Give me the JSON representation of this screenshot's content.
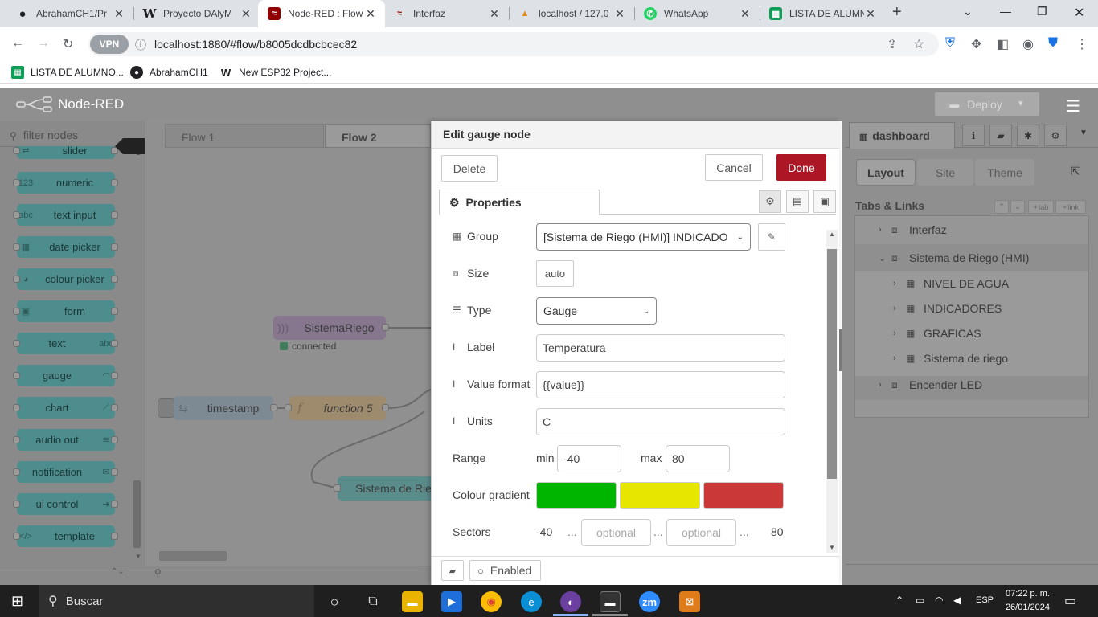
{
  "browser": {
    "tabs": [
      {
        "title": "AbrahamCH1/Pr",
        "favicon": "github-icon",
        "active": false
      },
      {
        "title": "Proyecto DAlyM",
        "favicon": "wordpress-icon",
        "active": false
      },
      {
        "title": "Node-RED : Flow",
        "favicon": "nodered-icon",
        "active": true
      },
      {
        "title": "Interfaz",
        "favicon": "nodered-icon",
        "active": false
      },
      {
        "title": "localhost / 127.0",
        "favicon": "phpmyadmin-icon",
        "active": false
      },
      {
        "title": "WhatsApp",
        "favicon": "whatsapp-icon",
        "active": false
      },
      {
        "title": "LISTA DE ALUMN",
        "favicon": "sheets-icon",
        "active": false
      }
    ],
    "url": "localhost:1880/#flow/b8005dcdbcbcec82",
    "vpn_label": "VPN",
    "bookmarks": [
      {
        "label": "LISTA DE ALUMNO...",
        "icon": "sheets-icon"
      },
      {
        "label": "AbrahamCH1",
        "icon": "github-icon"
      },
      {
        "label": "New ESP32 Project...",
        "icon": "wokwi-icon"
      }
    ]
  },
  "nodered": {
    "app_title": "Node-RED",
    "deploy_label": "Deploy",
    "palette": {
      "filter_placeholder": "filter nodes",
      "nodes": [
        {
          "label": "slider",
          "icon": "slider-icon"
        },
        {
          "label": "numeric",
          "icon": "numeric-icon"
        },
        {
          "label": "text input",
          "icon": "text-input-icon"
        },
        {
          "label": "date picker",
          "icon": "calendar-icon"
        },
        {
          "label": "colour picker",
          "icon": "palette-icon"
        },
        {
          "label": "form",
          "icon": "form-icon"
        },
        {
          "label": "text",
          "icon": "text-icon"
        },
        {
          "label": "gauge",
          "icon": "gauge-icon"
        },
        {
          "label": "chart",
          "icon": "chart-icon"
        },
        {
          "label": "audio out",
          "icon": "audio-icon"
        },
        {
          "label": "notification",
          "icon": "envelope-icon"
        },
        {
          "label": "ui control",
          "icon": "arrow-icon"
        },
        {
          "label": "template",
          "icon": "code-icon"
        }
      ]
    },
    "workspace": {
      "tabs": [
        "Flow 1",
        "Flow 2"
      ],
      "flow_nodes": {
        "sistema_riego": "SistemaRiego",
        "status_connected": "connected",
        "timestamp": "timestamp",
        "function5": "function 5",
        "sistema_de_rie": "Sistema de Rie"
      }
    },
    "tray": {
      "title": "Edit gauge node",
      "delete_label": "Delete",
      "cancel_label": "Cancel",
      "done_label": "Done",
      "properties_tab": "Properties",
      "fields": {
        "group_label": "Group",
        "group_value": "[Sistema de Riego (HMI)] INDICADORES",
        "size_label": "Size",
        "size_value": "auto",
        "type_label": "Type",
        "type_value": "Gauge",
        "label_label": "Label",
        "label_value": "Temperatura",
        "value_format_label": "Value format",
        "value_format_value": "{{value}}",
        "units_label": "Units",
        "units_value": "C",
        "range_label": "Range",
        "min_label": "min",
        "min_value": "-40",
        "max_label": "max",
        "max_value": "80",
        "colour_gradient_label": "Colour gradient",
        "colours": [
          "#00b500",
          "#e6e600",
          "#ca3838"
        ],
        "sectors_label": "Sectors",
        "sector_start": "-40",
        "sector_sep": "...",
        "sector_placeholder_1": "optional",
        "sector_placeholder_2": "optional",
        "sector_end": "80"
      },
      "enabled_label": "Enabled"
    },
    "sidebar": {
      "tab_label": "dashboard",
      "pills": [
        "Layout",
        "Site",
        "Theme"
      ],
      "section_title": "Tabs & Links",
      "small_buttons": [
        "tab",
        "link"
      ],
      "tree": [
        {
          "label": "Interfaz",
          "level": 0,
          "expanded": false
        },
        {
          "label": "Sistema de Riego (HMI)",
          "level": 0,
          "expanded": true
        },
        {
          "label": "NIVEL DE AGUA",
          "level": 1,
          "expanded": false
        },
        {
          "label": "INDICADORES",
          "level": 1,
          "expanded": false
        },
        {
          "label": "GRAFICAS",
          "level": 1,
          "expanded": false
        },
        {
          "label": "Sistema de riego",
          "level": 1,
          "expanded": false
        },
        {
          "label": "Encender LED",
          "level": 0,
          "expanded": false
        }
      ]
    }
  },
  "taskbar": {
    "search_placeholder": "Buscar",
    "language": "ESP",
    "time": "07:22 p. m.",
    "date": "26/01/2024"
  }
}
